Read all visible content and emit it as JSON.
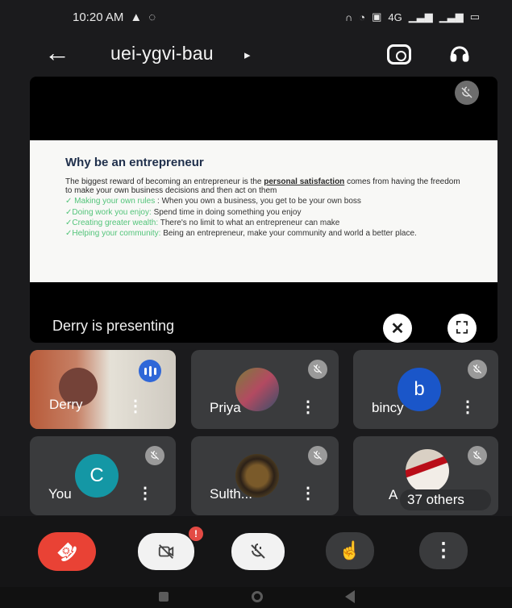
{
  "status": {
    "time": "10:20 AM",
    "left_icons": [
      "warning-icon",
      "notification-icon"
    ],
    "right_icons": [
      "headset-icon",
      "alarm-icon",
      "screen-icon",
      "signal-icon",
      "signal-icon",
      "battery-icon"
    ],
    "network_small": "4G"
  },
  "header": {
    "meeting_code": "uei-ygvi-bau",
    "chevron": "▸"
  },
  "presentation": {
    "slide": {
      "title": "Why be an entrepreneur",
      "intro_before_link": "The biggest reward of becoming an entrepreneur is the ",
      "intro_link": "personal satisfaction",
      "intro_after_link": " comes from having the freedom to make your own business decisions and then act on them",
      "bullets": [
        {
          "lead": "Making your own rules",
          "sep": " : ",
          "text": "When you own a business, you get to be your own boss"
        },
        {
          "lead": "Doing work you enjoy:",
          "sep": " ",
          "text": "Spend time in doing something you enjoy"
        },
        {
          "lead": "Creating greater wealth:",
          "sep": " ",
          "text": "There's no limit to what an entrepreneur can make"
        },
        {
          "lead": "Helping your community:",
          "sep": " ",
          "text": "Being an entrepreneur, make your community and world a better place."
        }
      ]
    },
    "label": "Derry is presenting"
  },
  "participants": [
    {
      "name": "Derry",
      "avatar": "photo",
      "speaking": true
    },
    {
      "name": "Priya",
      "avatar": "photo"
    },
    {
      "name": "bincy",
      "avatar": "b",
      "color": "#1a56c9"
    },
    {
      "name": "You",
      "avatar": "C",
      "color": "#1497a5"
    },
    {
      "name": "Sulth...",
      "avatar": "photo"
    },
    {
      "name": "37 others",
      "avatar": "photo",
      "partial": "A"
    }
  ],
  "controls": {
    "badge": "!",
    "colors": {
      "end_call": "#e94235",
      "video_off": "#f2f2f2",
      "mic_off": "#f2f2f2",
      "hand": "#3a3b3d",
      "more": "#3a3b3d"
    }
  }
}
